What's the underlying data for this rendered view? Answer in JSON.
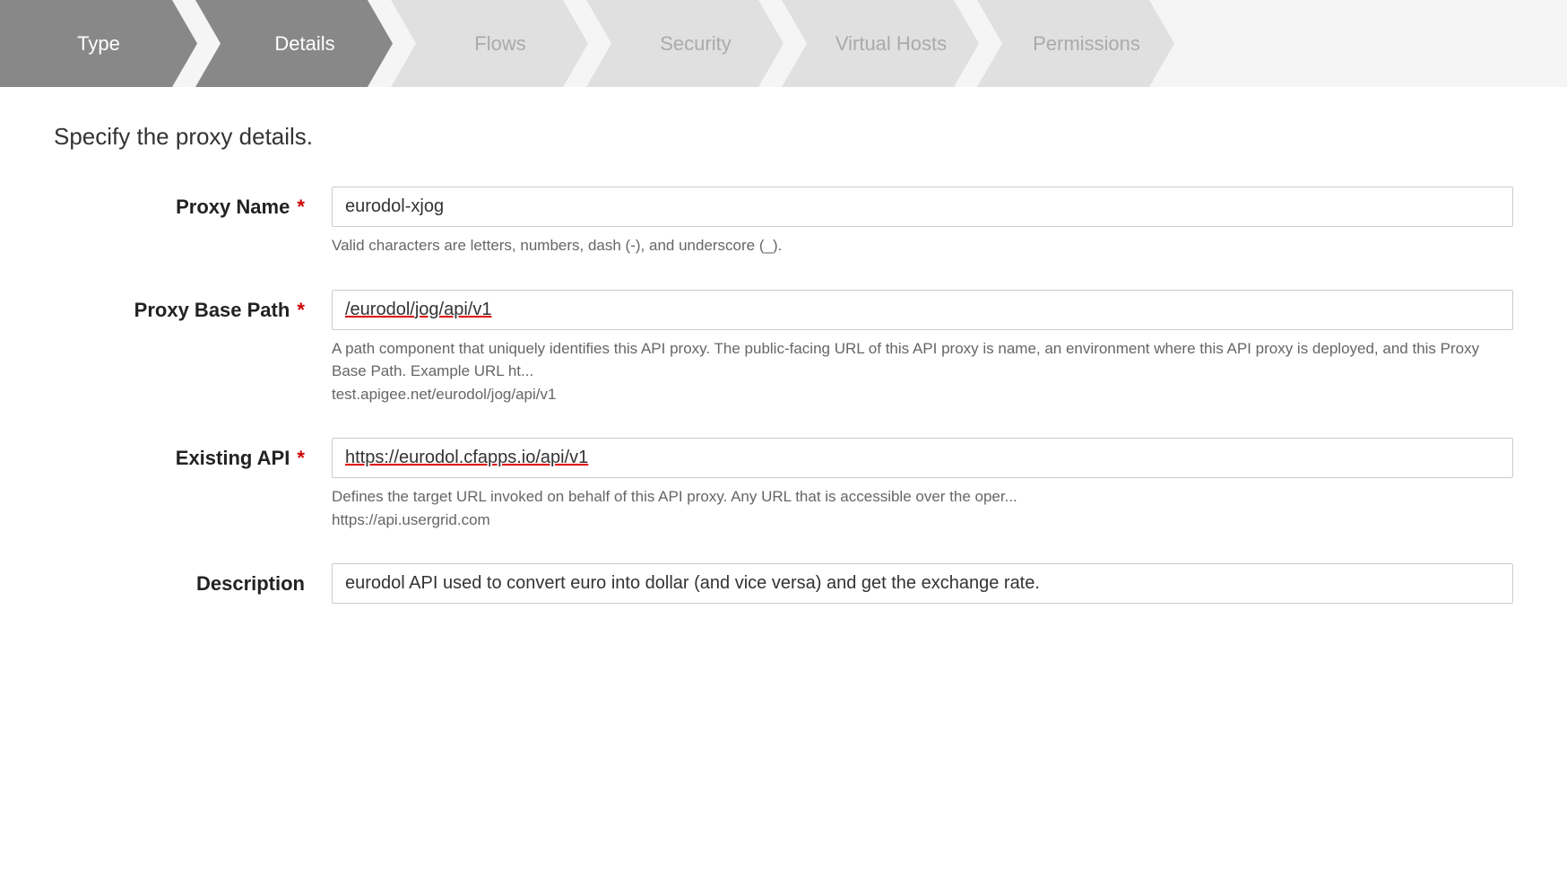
{
  "stepper": {
    "steps": [
      {
        "id": "type",
        "label": "Type",
        "state": "completed"
      },
      {
        "id": "details",
        "label": "Details",
        "state": "active"
      },
      {
        "id": "flows",
        "label": "Flows",
        "state": "inactive"
      },
      {
        "id": "security",
        "label": "Security",
        "state": "inactive"
      },
      {
        "id": "virtual-hosts",
        "label": "Virtual Hosts",
        "state": "inactive"
      },
      {
        "id": "permissions",
        "label": "Permissions",
        "state": "inactive"
      }
    ]
  },
  "page": {
    "subtitle": "Specify the proxy details.",
    "proxy_name": {
      "label": "Proxy Name",
      "required": true,
      "value": "eurodol-xjog",
      "hint": "Valid characters are letters, numbers, dash (-), and underscore (_)."
    },
    "proxy_base_path": {
      "label": "Proxy Base Path",
      "required": true,
      "value": "/eurodol/jog/api/v1",
      "hint": "A path component that uniquely identifies this API proxy. The public-facing URL of this API proxy is name, an environment where this API proxy is deployed, and this Proxy Base Path. Example URL ht... test.apigee.net/eurodol/jog/api/v1"
    },
    "existing_api": {
      "label": "Existing API",
      "required": true,
      "value": "https://eurodol.cfapps.io/api/v1",
      "hint": "Defines the target URL invoked on behalf of this API proxy. Any URL that is accessible over the oper... https://api.usergrid.com"
    },
    "description": {
      "label": "Description",
      "required": false,
      "value": "eurodol API used to convert euro into dollar (and vice versa) and get the exchange rate."
    }
  }
}
